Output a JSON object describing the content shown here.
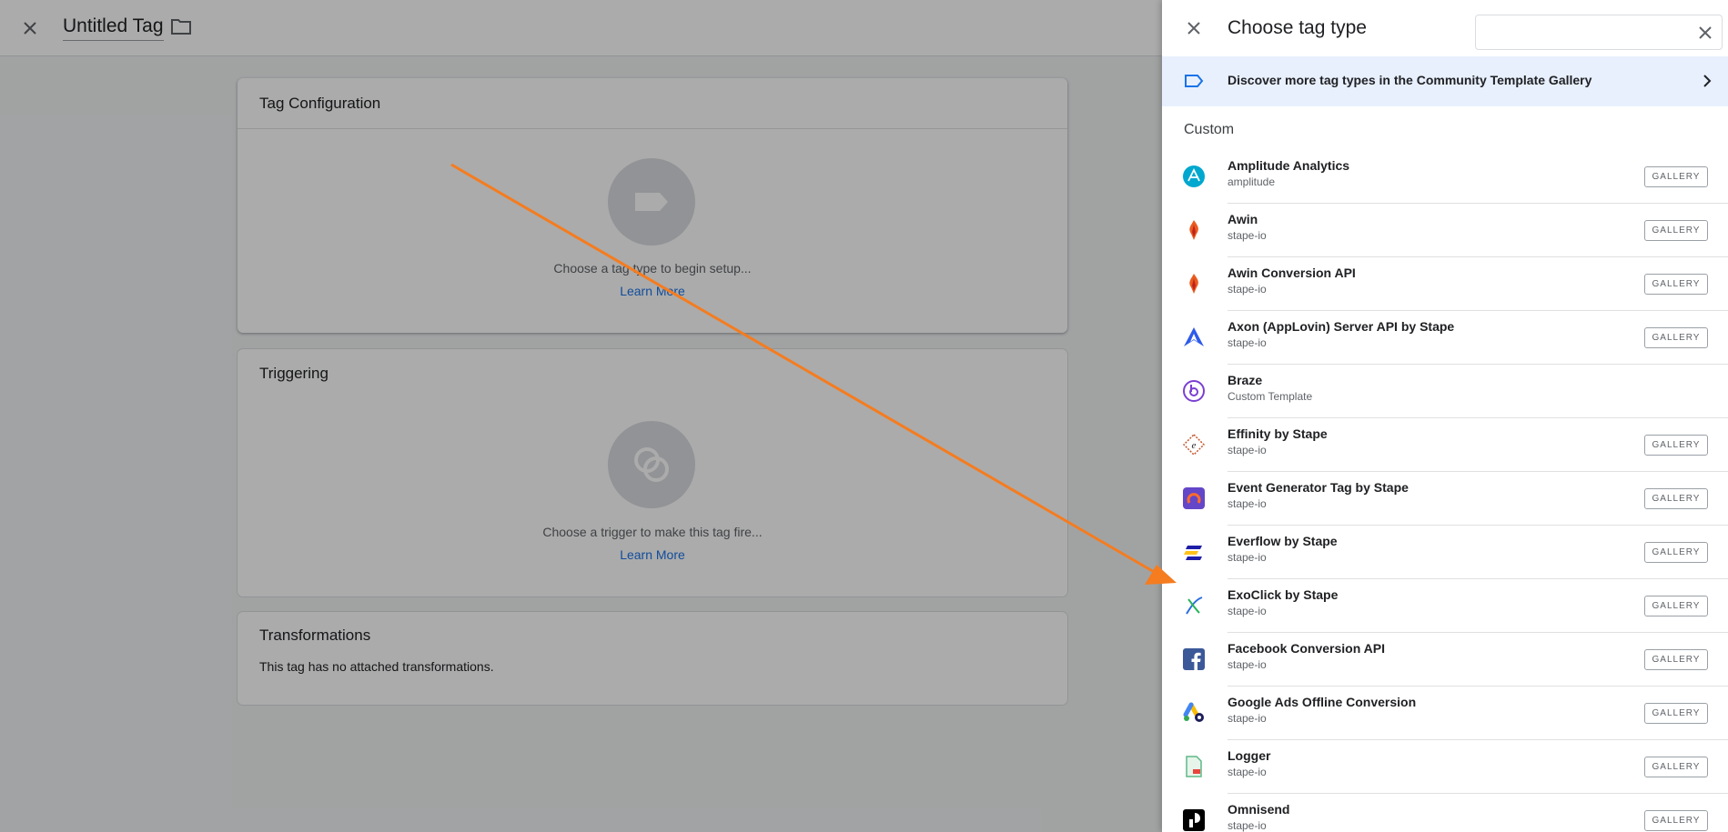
{
  "editor": {
    "title": "Untitled Tag",
    "config_card": {
      "title": "Tag Configuration",
      "hint": "Choose a tag type to begin setup...",
      "learn_more": "Learn More"
    },
    "trigger_card": {
      "title": "Triggering",
      "hint": "Choose a trigger to make this tag fire...",
      "learn_more": "Learn More"
    },
    "transform_card": {
      "title": "Transformations",
      "text": "This tag has no attached transformations."
    }
  },
  "panel": {
    "title": "Choose tag type",
    "search": {
      "value": "",
      "placeholder": ""
    },
    "banner": "Discover more tag types in the Community Template Gallery",
    "section": "Custom",
    "gallery_label": "GALLERY",
    "items": [
      {
        "name": "Amplitude Analytics",
        "sub": "amplitude",
        "icon": "amplitude-icon",
        "gallery": true
      },
      {
        "name": "Awin",
        "sub": "stape-io",
        "icon": "awin-icon",
        "gallery": true
      },
      {
        "name": "Awin Conversion API",
        "sub": "stape-io",
        "icon": "awin-icon",
        "gallery": true
      },
      {
        "name": "Axon (AppLovin) Server API by Stape",
        "sub": "stape-io",
        "icon": "axon-icon",
        "gallery": true
      },
      {
        "name": "Braze",
        "sub": "Custom Template",
        "icon": "braze-icon",
        "gallery": false
      },
      {
        "name": "Effinity by Stape",
        "sub": "stape-io",
        "icon": "effinity-icon",
        "gallery": true
      },
      {
        "name": "Event Generator Tag by Stape",
        "sub": "stape-io",
        "icon": "event-generator-icon",
        "gallery": true
      },
      {
        "name": "Everflow by Stape",
        "sub": "stape-io",
        "icon": "everflow-icon",
        "gallery": true
      },
      {
        "name": "ExoClick by Stape",
        "sub": "stape-io",
        "icon": "exoclick-icon",
        "gallery": true
      },
      {
        "name": "Facebook Conversion API",
        "sub": "stape-io",
        "icon": "facebook-icon",
        "gallery": true
      },
      {
        "name": "Google Ads Offline Conversion",
        "sub": "stape-io",
        "icon": "google-ads-icon",
        "gallery": true
      },
      {
        "name": "Logger",
        "sub": "stape-io",
        "icon": "logger-icon",
        "gallery": true
      },
      {
        "name": "Omnisend",
        "sub": "stape-io",
        "icon": "omnisend-icon",
        "gallery": true
      }
    ]
  },
  "colors": {
    "accent": "#1a73e8",
    "banner_bg": "#e8f0fe",
    "arrow": "#f57c1f"
  }
}
